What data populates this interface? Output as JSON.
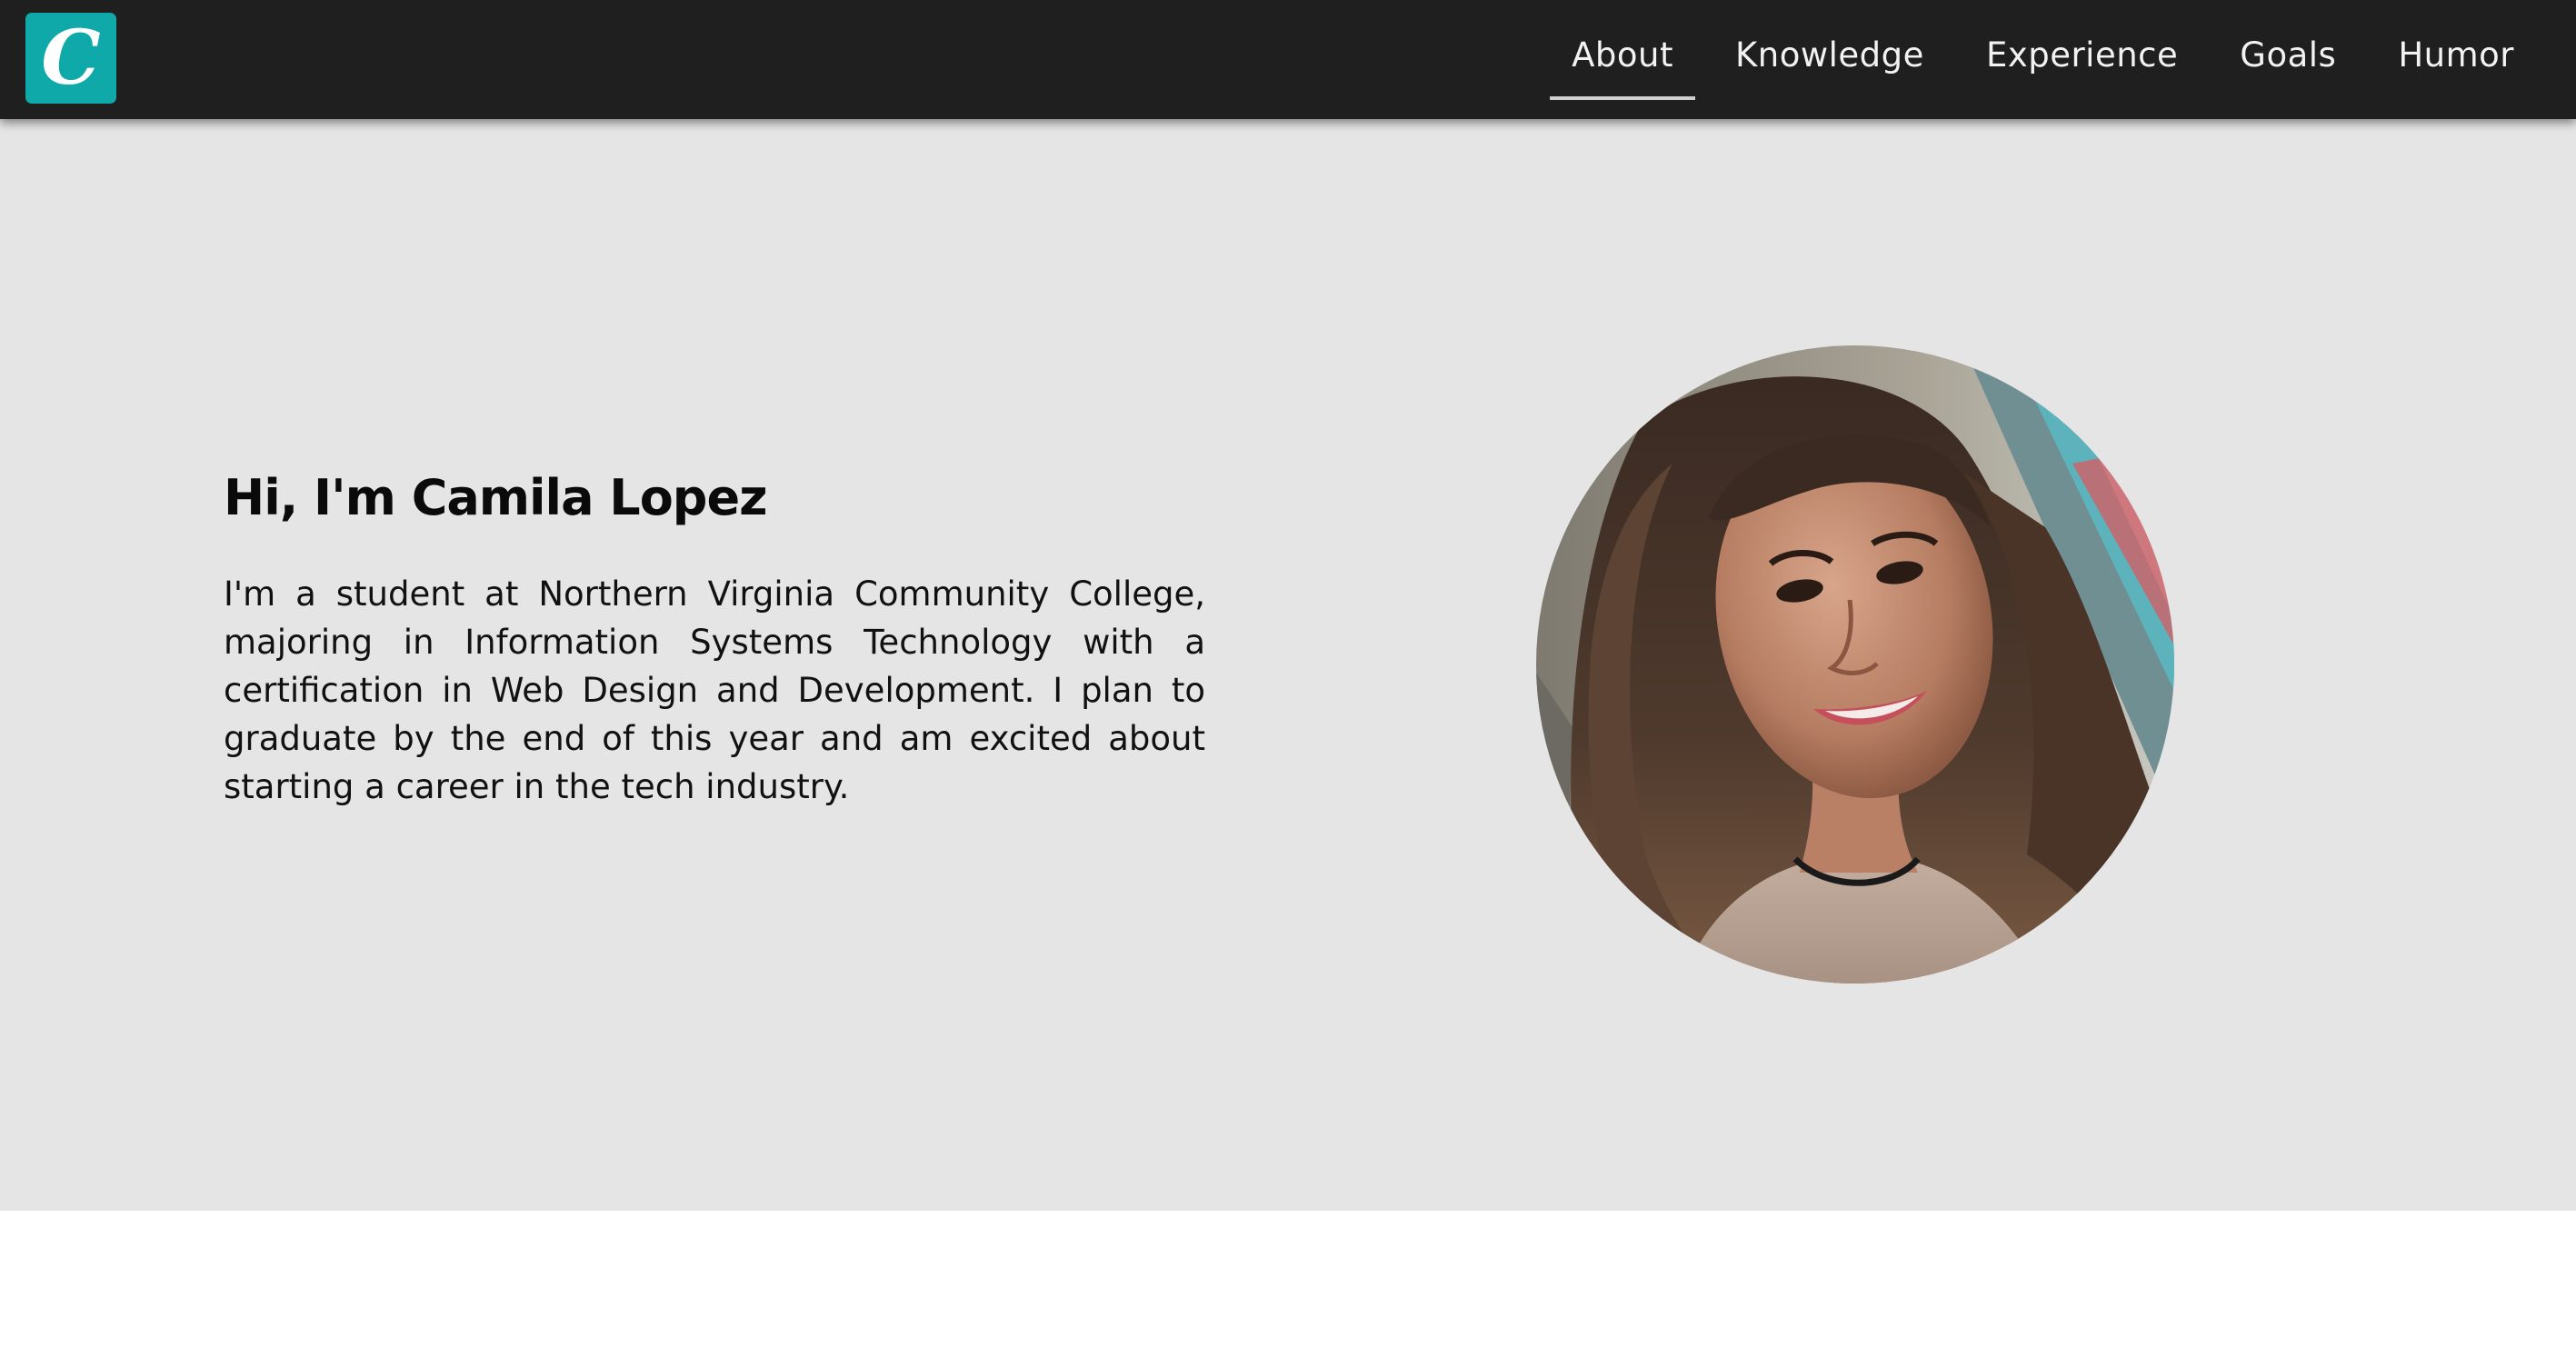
{
  "logo": {
    "letter": "C"
  },
  "nav": {
    "items": [
      {
        "label": "About",
        "active": true
      },
      {
        "label": "Knowledge"
      },
      {
        "label": "Experience"
      },
      {
        "label": "Goals"
      },
      {
        "label": "Humor"
      }
    ]
  },
  "hero": {
    "heading": "Hi, I'm Camila Lopez",
    "intro": "I'm a student at Northern Virginia Community College, majoring in Information Systems Technology with a certification in Web Design and Development. I plan to graduate by the end of this year and am excited about starting a career in the tech industry."
  },
  "colors": {
    "navbar": "#1f1f1f",
    "logo_bg": "#10a9aa",
    "hero_bg": "#e5e5e5"
  }
}
